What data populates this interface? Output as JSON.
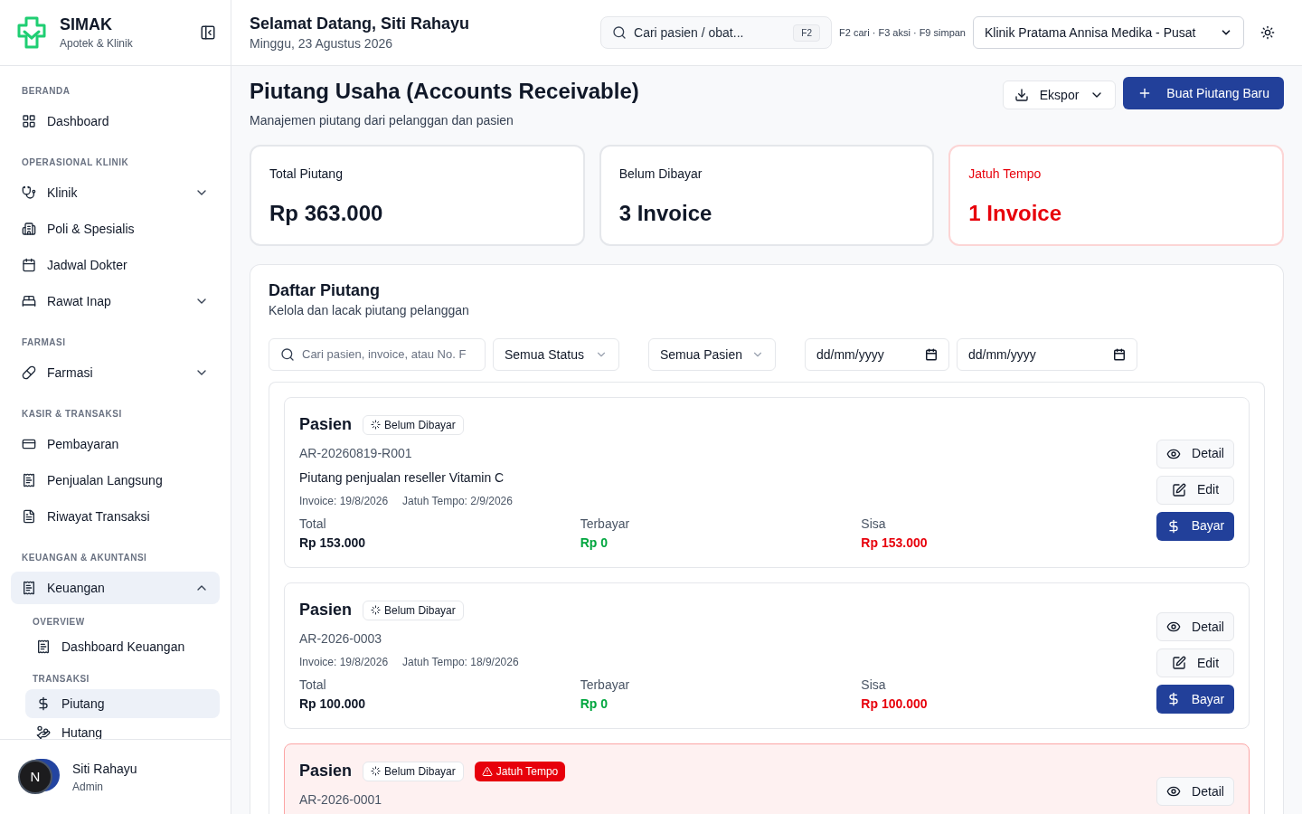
{
  "brand": {
    "name": "SIMAK",
    "tagline": "Apotek & Klinik"
  },
  "sidebar": {
    "sections": [
      {
        "title": "BERANDA",
        "items": [
          {
            "label": "Dashboard",
            "selected": false
          }
        ]
      },
      {
        "title": "OPERASIONAL KLINIK",
        "items": [
          {
            "label": "Klinik",
            "selected": false,
            "expanded": false
          },
          {
            "label": "Poli & Spesialis",
            "selected": false
          },
          {
            "label": "Jadwal Dokter",
            "selected": false
          },
          {
            "label": "Rawat Inap",
            "selected": false,
            "expanded": false
          }
        ]
      },
      {
        "title": "FARMASI",
        "items": [
          {
            "label": "Farmasi",
            "selected": false,
            "expanded": false
          }
        ]
      },
      {
        "title": "KASIR & TRANSAKSI",
        "items": [
          {
            "label": "Pembayaran",
            "selected": false
          },
          {
            "label": "Penjualan Langsung",
            "selected": false
          },
          {
            "label": "Riwayat Transaksi",
            "selected": false
          }
        ]
      },
      {
        "title": "KEUANGAN & AKUNTANSI",
        "items": [
          {
            "label": "Keuangan",
            "selected": true,
            "expanded": true,
            "children": [
              {
                "title": "OVERVIEW",
                "items": [
                  {
                    "label": "Dashboard Keuangan",
                    "selected": false
                  }
                ]
              },
              {
                "title": "TRANSAKSI",
                "items": [
                  {
                    "label": "Piutang",
                    "selected": true
                  },
                  {
                    "label": "Hutang",
                    "selected": false
                  }
                ]
              }
            ]
          }
        ]
      }
    ]
  },
  "user": {
    "initial": "N",
    "name": "Siti Rahayu",
    "role": "Admin"
  },
  "header": {
    "greeting": "Selamat Datang, Siti Rahayu",
    "date": "Minggu, 23 Agustus 2026",
    "search": {
      "placeholder": "Cari pasien / obat..."
    },
    "shortcut": "F2",
    "hints": "F2 cari · F3 aksi · F9 simpan",
    "clinic": "Klinik Pratama Annisa Medika - Pusat"
  },
  "page": {
    "title": "Piutang Usaha (Accounts Receivable)",
    "subtitle": "Manajemen piutang dari pelanggan dan pasien",
    "export_button": "Ekspor",
    "create_button": "Buat Piutang Baru"
  },
  "stats": [
    {
      "label": "Total Piutang",
      "value": "Rp 363.000",
      "alert": false
    },
    {
      "label": "Belum Dibayar",
      "value": "3 Invoice",
      "alert": false
    },
    {
      "label": "Jatuh Tempo",
      "value": "1 Invoice",
      "alert": true
    }
  ],
  "list": {
    "title": "Daftar Piutang",
    "subtitle": "Kelola dan lacak piutang pelanggan",
    "filters": {
      "search": {
        "placeholder": "Cari pasien, invoice, atau No. F"
      },
      "status": "Semua Status",
      "patient": "Semua Pasien",
      "date_from": "dd/mm/yyyy",
      "date_to": "dd/mm/yyyy"
    },
    "items": [
      {
        "name": "Pasien",
        "overdue": false,
        "badges": [
          {
            "label": "Belum Dibayar",
            "kind": "status"
          }
        ],
        "number": "AR-20260819-R001",
        "description": "Piutang penjualan reseller Vitamin C",
        "invoice": "Invoice: 19/8/2026",
        "due": "Jatuh Tempo: 2/9/2026",
        "amounts": [
          {
            "label": "Total",
            "value": "Rp 153.000",
            "kind": "total"
          },
          {
            "label": "Terbayar",
            "value": "Rp 0",
            "kind": "paid"
          },
          {
            "label": "Sisa",
            "value": "Rp 153.000",
            "kind": "remaining"
          }
        ],
        "actions": [
          {
            "label": "Detail",
            "kind": "view"
          },
          {
            "label": "Edit",
            "kind": "edit"
          },
          {
            "label": "Bayar",
            "kind": "pay"
          }
        ]
      },
      {
        "name": "Pasien",
        "overdue": false,
        "badges": [
          {
            "label": "Belum Dibayar",
            "kind": "status"
          }
        ],
        "number": "AR-2026-0003",
        "invoice": "Invoice: 19/8/2026",
        "due": "Jatuh Tempo: 18/9/2026",
        "amounts": [
          {
            "label": "Total",
            "value": "Rp 100.000",
            "kind": "total"
          },
          {
            "label": "Terbayar",
            "value": "Rp 0",
            "kind": "paid"
          },
          {
            "label": "Sisa",
            "value": "Rp 100.000",
            "kind": "remaining"
          }
        ],
        "actions": [
          {
            "label": "Detail",
            "kind": "view"
          },
          {
            "label": "Edit",
            "kind": "edit"
          },
          {
            "label": "Bayar",
            "kind": "pay"
          }
        ]
      },
      {
        "name": "Pasien",
        "overdue": true,
        "badges": [
          {
            "label": "Belum Dibayar",
            "kind": "status"
          },
          {
            "label": "Jatuh Tempo",
            "kind": "overdue"
          }
        ],
        "number": "AR-2026-0001",
        "actions": [
          {
            "label": "Detail",
            "kind": "view"
          }
        ]
      }
    ]
  }
}
